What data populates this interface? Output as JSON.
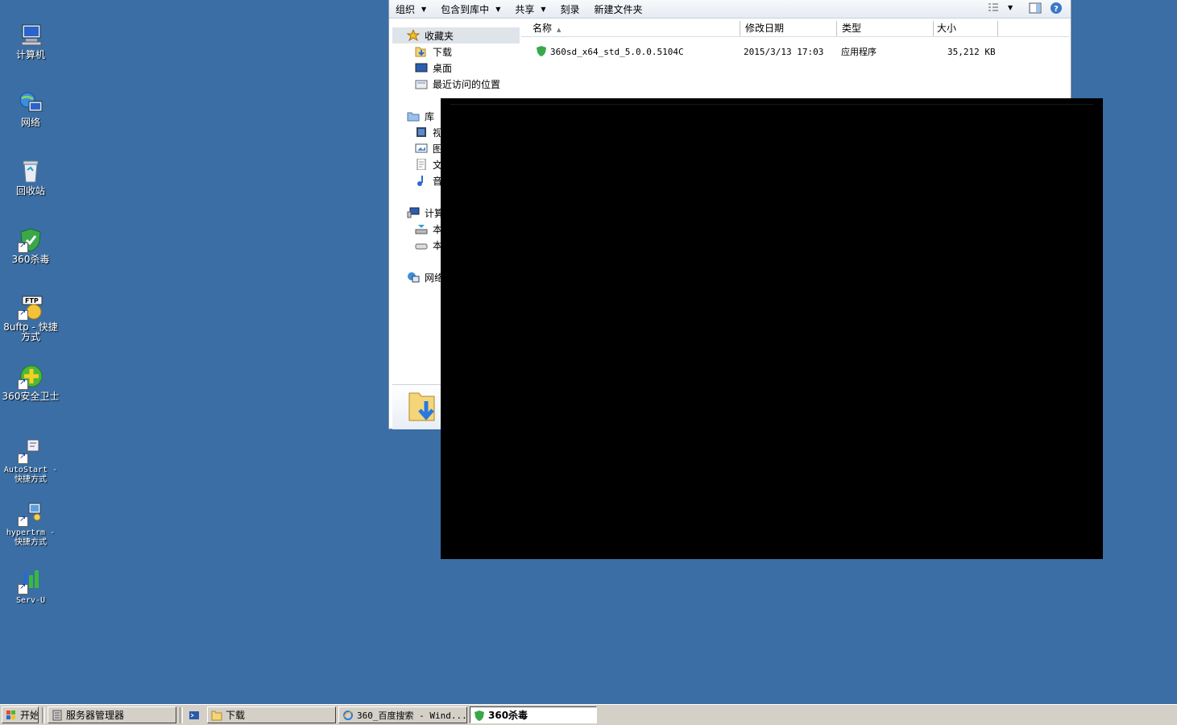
{
  "desktop": {
    "icons": [
      {
        "label": "计算机"
      },
      {
        "label": "网络"
      },
      {
        "label": "回收站"
      },
      {
        "label": "360杀毒"
      },
      {
        "label": "8uftp - 快捷方式"
      },
      {
        "label": "360安全卫士"
      },
      {
        "label": "AutoStart - 快捷方式"
      },
      {
        "label": "hypertrm - 快捷方式"
      },
      {
        "label": "Serv-U"
      }
    ]
  },
  "explorer": {
    "toolbar": {
      "organize": "组织",
      "include_library": "包含到库中",
      "share": "共享",
      "burn": "刻录",
      "new_folder": "新建文件夹"
    },
    "nav": {
      "favorites": "收藏夹",
      "downloads": "下载",
      "desktop": "桌面",
      "recent": "最近访问的位置",
      "libraries": "库",
      "videos": "视",
      "pictures": "图",
      "documents": "文",
      "music": "音",
      "computer": "计算",
      "local1": "本",
      "local2": "本",
      "network": "网络"
    },
    "columns": {
      "name": "名称",
      "modified": "修改日期",
      "type": "类型",
      "size": "大小"
    },
    "files": [
      {
        "name": "360sd_x64_std_5.0.0.5104C",
        "modified": "2015/3/13 17:03",
        "type": "应用程序",
        "size": "35,212 KB"
      }
    ]
  },
  "taskbar": {
    "start": "开始",
    "server_manager": "服务器管理器",
    "downloads": "下载",
    "ie": "360_百度搜索 - Wind...",
    "antivirus": "360杀毒"
  },
  "colors": {
    "desktop": "#3a6ea5",
    "taskbar": "#d4d0c8"
  }
}
